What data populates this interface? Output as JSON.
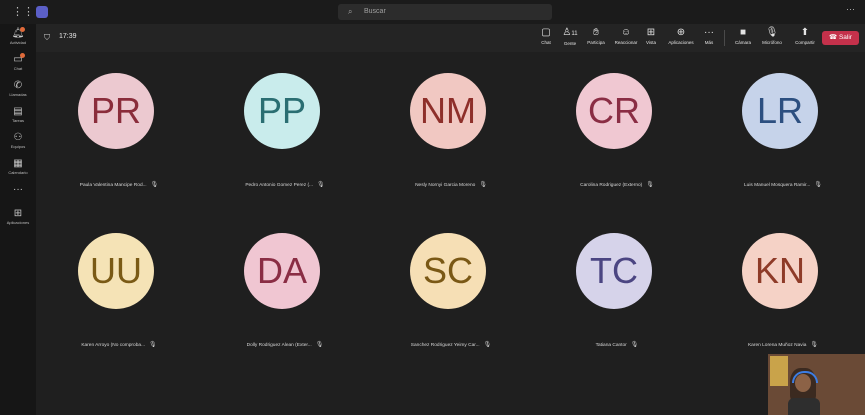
{
  "topbar": {
    "search_placeholder": "Buscar",
    "more_label": "···"
  },
  "rail": {
    "items": [
      {
        "label": "Actividad",
        "icon": "bell-icon",
        "badge": true
      },
      {
        "label": "Chat",
        "icon": "chat-icon",
        "badge": true
      },
      {
        "label": "Llamadas",
        "icon": "phone-icon",
        "badge": false
      },
      {
        "label": "Tareas",
        "icon": "clipboard-icon",
        "badge": false
      },
      {
        "label": "Equipos",
        "icon": "teams-icon",
        "badge": false
      },
      {
        "label": "Calendario",
        "icon": "calendar-icon",
        "badge": false
      },
      {
        "label": "···",
        "icon": "more-icon",
        "badge": false
      },
      {
        "label": "Aplicaciones",
        "icon": "apps-icon",
        "badge": false
      }
    ]
  },
  "callbar": {
    "timer": "17:39",
    "people_count": "11",
    "buttons": {
      "chat": "Chat",
      "people": "Gente",
      "raise": "Participa",
      "react": "Reaccionar",
      "view": "Vista",
      "apps": "Aplicaciones",
      "more": "Más",
      "camera": "Cámara",
      "mic": "Micrófono",
      "share": "Compartir",
      "leave": "Salir"
    }
  },
  "participants": [
    {
      "initials": "PR",
      "name": "Paula Valentina Mancipe Rod...",
      "bg": "#ecc9d0",
      "fg": "#8a2d3b"
    },
    {
      "initials": "PP",
      "name": "Pedro Antonio Gomez Perez (...",
      "bg": "#c9ecec",
      "fg": "#2a6e72"
    },
    {
      "initials": "NM",
      "name": "Nesly Nornyi Garcia Moreno",
      "bg": "#f1c8c2",
      "fg": "#8e2f2a"
    },
    {
      "initials": "CR",
      "name": "Carolina Rodriguez (Externo)",
      "bg": "#f0c8d2",
      "fg": "#8a2d44"
    },
    {
      "initials": "LR",
      "name": "Luis Manuel Mosquera Ramir...",
      "bg": "#c6d3ea",
      "fg": "#2c4f80"
    },
    {
      "initials": "UU",
      "name": "Karen Arroyo (No comproba...",
      "bg": "#f5e3b6",
      "fg": "#7a5a15"
    },
    {
      "initials": "DA",
      "name": "Dolly Rodriguez Alean (Exter...",
      "bg": "#f0c6d2",
      "fg": "#8a2d44"
    },
    {
      "initials": "SC",
      "name": "Sanchez Rodriguez Yeimy Car...",
      "bg": "#f6dfb5",
      "fg": "#7a5815"
    },
    {
      "initials": "TC",
      "name": "Tatiana Cantor",
      "bg": "#d6d3ea",
      "fg": "#4b4582"
    },
    {
      "initials": "KN",
      "name": "Karen Lorena Muñoz Navia",
      "bg": "#f5d2c6",
      "fg": "#8e3b28"
    }
  ]
}
